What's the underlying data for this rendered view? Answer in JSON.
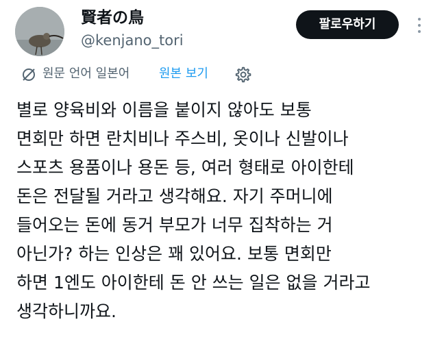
{
  "profile": {
    "display_name": "賢者の鳥",
    "handle": "@kenjano_tori",
    "avatar_icon": "bird-avatar"
  },
  "actions": {
    "follow_label": "팔로우하기",
    "more_icon": "more-dots-icon"
  },
  "translation": {
    "label": "원문 언어 일본어",
    "show_original_label": "원본 보기",
    "translate_icon": "translate-off-icon",
    "settings_icon": "gear-icon",
    "link_color": "#1d9bf0"
  },
  "tweet": {
    "lines": [
      "별로 양육비와 이름을 붙이지 않아도 보통",
      "면회만 하면 란치비나 주스비, 옷이나 신발이나",
      "스포츠 용품이나 용돈 등, 여러 형태로 아이한테",
      "돈은 전달될 거라고 생각해요. 자기 주머니에",
      "들어오는 돈에 동거 부모가 너무 집착하는 거",
      "아닌가? 하는 인상은 꽤 있어요. 보통 면회만",
      "하면 1엔도 아이한테 돈 안 쓰는 일은 없을 거라고",
      "생각하니까요."
    ]
  },
  "colors": {
    "text_primary": "#0f1419",
    "text_secondary": "#536471",
    "button_bg": "#0f1419",
    "button_text": "#ffffff"
  }
}
